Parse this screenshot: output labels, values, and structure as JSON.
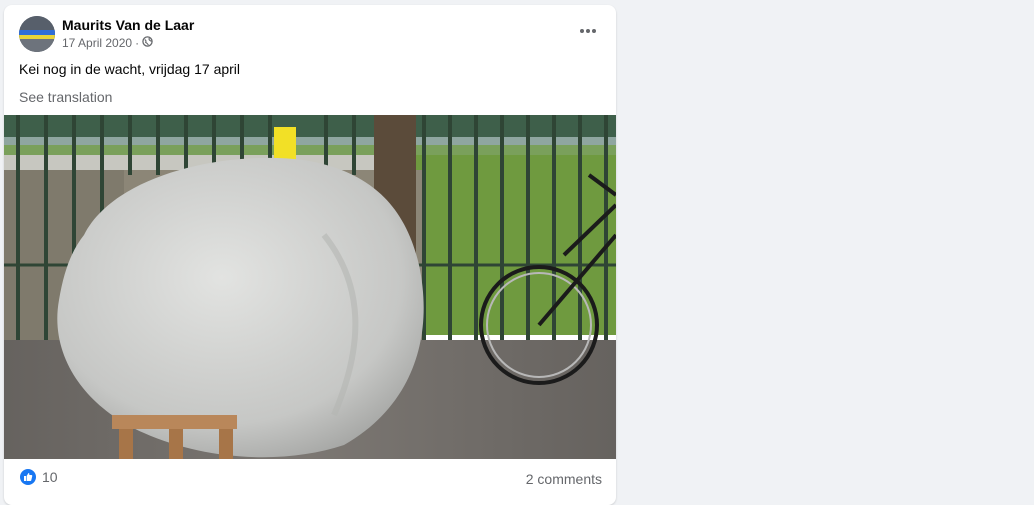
{
  "post": {
    "author": "Maurits Van de Laar",
    "date": "17 April 2020",
    "dot": "·",
    "privacy_icon": "globe-icon",
    "text": "Kei nog in de wacht, vrijdag 17 april",
    "see_translation": "See translation",
    "image_icon": "photo-boulder-at-fence",
    "reactions": {
      "icon": "like-icon",
      "count": "10"
    },
    "comments": "2 comments"
  },
  "colors": {
    "background": "#f0f2f5",
    "card": "#ffffff",
    "primary_text": "#050505",
    "secondary_text": "#65676b",
    "like_blue": "#1877f2"
  }
}
